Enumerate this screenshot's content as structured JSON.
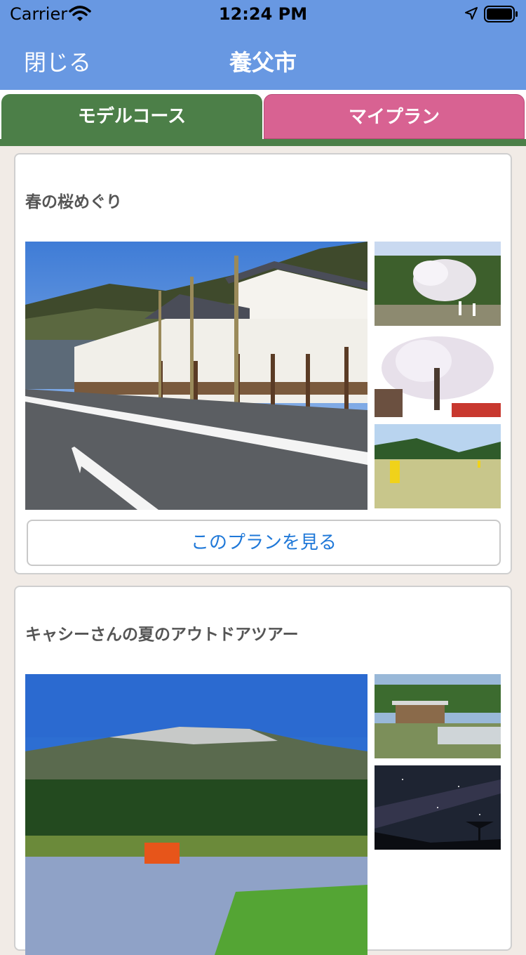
{
  "status": {
    "carrier": "Carrier",
    "time": "12:24 PM"
  },
  "nav": {
    "close_label": "閉じる",
    "title": "養父市"
  },
  "tabs": {
    "model_course": "モデルコース",
    "my_plan": "マイプラン"
  },
  "cards": [
    {
      "title": "春の桜めぐり",
      "button_label": "このプランを見る"
    },
    {
      "title": "キャシーさんの夏のアウトドアツアー"
    }
  ],
  "colors": {
    "header": "#6898e2",
    "tab_model": "#4c7f48",
    "tab_myplan": "#d86292",
    "button_text": "#1f78d8"
  }
}
